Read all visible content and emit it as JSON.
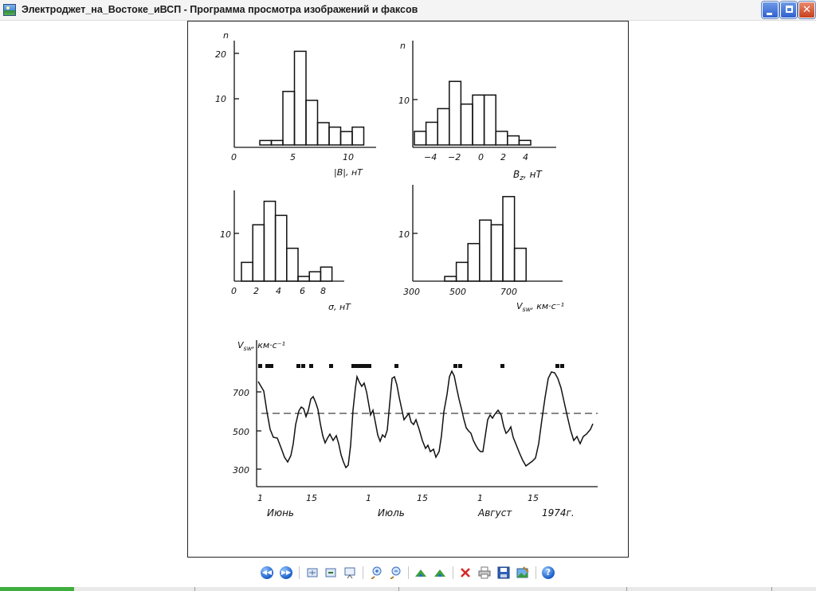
{
  "window": {
    "title": "Электроджет_на_Востоке_иВСП - Программа просмотра изображений и факсов"
  },
  "figure": {
    "hist_b": {
      "y_axis_label": "n",
      "y_ticks": [
        "20",
        "10"
      ],
      "x_ticks": [
        "0",
        "5",
        "10"
      ],
      "x_label": "|B|, нТ",
      "values": [
        1,
        1,
        12,
        21,
        10,
        5,
        4,
        3,
        4
      ]
    },
    "hist_bz": {
      "y_axis_label": "n",
      "y_ticks": [
        "10"
      ],
      "x_ticks": [
        "−4",
        "−2",
        "0",
        "2",
        "4"
      ],
      "x_label": "B",
      "x_label_sub": "z",
      "x_label_unit": ", нТ",
      "values": [
        3,
        5,
        8,
        14,
        9,
        11,
        11,
        3,
        2,
        1
      ]
    },
    "hist_sigma": {
      "y_ticks": [
        "10"
      ],
      "x_ticks": [
        "0",
        "2",
        "4",
        "6",
        "8"
      ],
      "x_label": "σ, нТ",
      "values": [
        4,
        12,
        17,
        14,
        7,
        1,
        2,
        3
      ]
    },
    "hist_vsw": {
      "y_ticks": [
        "10"
      ],
      "x_ticks": [
        "300",
        "500",
        "700"
      ],
      "x_label": "V",
      "x_label_sub": "sw",
      "x_label_unit": ", км·с⁻¹",
      "values": [
        1,
        4,
        8,
        13,
        12,
        18,
        7
      ]
    },
    "timeseries": {
      "y_axis_label": "V",
      "y_axis_label_sub": "sw",
      "y_axis_label_unit": ", км·с⁻¹",
      "y_ticks": [
        "700",
        "500",
        "300"
      ],
      "x_ticks": [
        "1",
        "15",
        "1",
        "15",
        "1",
        "15"
      ],
      "months": [
        "Июнь",
        "Июль",
        "Август"
      ],
      "year": "1974г.",
      "threshold": 600,
      "ylim": [
        250,
        850
      ]
    }
  },
  "toolbar": {
    "buttons": [
      {
        "name": "previous-image-button",
        "icon": "prev-icon"
      },
      {
        "name": "next-image-button",
        "icon": "next-icon"
      },
      {
        "name": "best-fit-button",
        "icon": "best-fit-icon"
      },
      {
        "name": "actual-size-button",
        "icon": "actual-size-icon"
      },
      {
        "name": "slideshow-button",
        "icon": "slideshow-icon"
      },
      {
        "name": "zoom-in-button",
        "icon": "zoom-in-icon"
      },
      {
        "name": "zoom-out-button",
        "icon": "zoom-out-icon"
      },
      {
        "name": "rotate-clockwise-button",
        "icon": "rotate-cw-icon"
      },
      {
        "name": "rotate-counterclockwise-button",
        "icon": "rotate-ccw-icon"
      },
      {
        "name": "delete-button",
        "icon": "delete-icon"
      },
      {
        "name": "print-button",
        "icon": "print-icon"
      },
      {
        "name": "save-button",
        "icon": "save-icon"
      },
      {
        "name": "edit-button",
        "icon": "edit-icon"
      },
      {
        "name": "help-button",
        "icon": "help-icon"
      }
    ],
    "colors": {
      "nav": "#1b5fc7",
      "delete": "#d8282a",
      "rotate": "#3f9f3a"
    }
  }
}
